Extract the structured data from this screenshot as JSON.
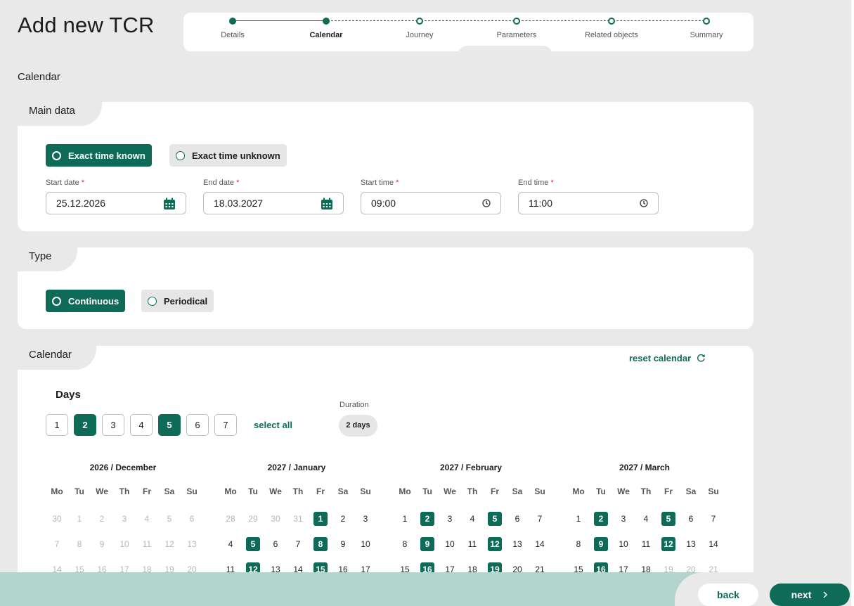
{
  "page": {
    "title": "Add new TCR"
  },
  "stepper": {
    "steps": [
      {
        "label": "Details",
        "state": "done"
      },
      {
        "label": "Calendar",
        "state": "active"
      },
      {
        "label": "Journey",
        "state": "todo"
      },
      {
        "label": "Parameters",
        "state": "todo"
      },
      {
        "label": "Related objects",
        "state": "todo"
      },
      {
        "label": "Summary",
        "state": "todo"
      }
    ]
  },
  "section_title": "Calendar",
  "main_data": {
    "title": "Main data",
    "time_mode": {
      "options": [
        "Exact time known",
        "Exact time unknown"
      ],
      "selected": "Exact time known"
    },
    "fields": {
      "start_date": {
        "label": "Start date",
        "value": "25.12.2026",
        "required_mark": "*"
      },
      "end_date": {
        "label": "End date",
        "value": "18.03.2027",
        "required_mark": "*"
      },
      "start_time": {
        "label": "Start time",
        "value": "09:00",
        "required_mark": "*"
      },
      "end_time": {
        "label": "End time",
        "value": "11:00",
        "required_mark": "*"
      }
    }
  },
  "type": {
    "title": "Type",
    "options": [
      "Continuous",
      "Periodical"
    ],
    "selected": "Continuous"
  },
  "calendar": {
    "title": "Calendar",
    "reset_label": "reset calendar",
    "days_title": "Days",
    "days": [
      "1",
      "2",
      "3",
      "4",
      "5",
      "6",
      "7"
    ],
    "selected_days": [
      "2",
      "5"
    ],
    "select_all_label": "select all",
    "duration_label": "Duration",
    "duration_value": "2 days",
    "weekdays": [
      "Mo",
      "Tu",
      "We",
      "Th",
      "Fr",
      "Sa",
      "Su"
    ],
    "months": [
      {
        "title": "2026 / December",
        "rows": [
          [
            [
              "30",
              "m"
            ],
            [
              "1",
              "m"
            ],
            [
              "2",
              "m"
            ],
            [
              "3",
              "m"
            ],
            [
              "4",
              "m"
            ],
            [
              "5",
              "m"
            ],
            [
              "6",
              "m"
            ]
          ],
          [
            [
              "7",
              "m"
            ],
            [
              "8",
              "m"
            ],
            [
              "9",
              "m"
            ],
            [
              "10",
              "m"
            ],
            [
              "11",
              "m"
            ],
            [
              "12",
              "m"
            ],
            [
              "13",
              "m"
            ]
          ],
          [
            [
              "14",
              "m"
            ],
            [
              "15",
              "m"
            ],
            [
              "16",
              "m"
            ],
            [
              "17",
              "m"
            ],
            [
              "18",
              "m"
            ],
            [
              "19",
              "m"
            ],
            [
              "20",
              "m"
            ]
          ]
        ]
      },
      {
        "title": "2027 / January",
        "rows": [
          [
            [
              "28",
              "m"
            ],
            [
              "29",
              "m"
            ],
            [
              "30",
              "m"
            ],
            [
              "31",
              "m"
            ],
            [
              "1",
              "h"
            ],
            [
              "2",
              "n"
            ],
            [
              "3",
              "n"
            ]
          ],
          [
            [
              "4",
              "n"
            ],
            [
              "5",
              "h"
            ],
            [
              "6",
              "n"
            ],
            [
              "7",
              "n"
            ],
            [
              "8",
              "h"
            ],
            [
              "9",
              "n"
            ],
            [
              "10",
              "n"
            ]
          ],
          [
            [
              "11",
              "n"
            ],
            [
              "12",
              "h"
            ],
            [
              "13",
              "n"
            ],
            [
              "14",
              "n"
            ],
            [
              "15",
              "h"
            ],
            [
              "16",
              "n"
            ],
            [
              "17",
              "n"
            ]
          ]
        ]
      },
      {
        "title": "2027 / February",
        "rows": [
          [
            [
              "1",
              "n"
            ],
            [
              "2",
              "h"
            ],
            [
              "3",
              "n"
            ],
            [
              "4",
              "n"
            ],
            [
              "5",
              "h"
            ],
            [
              "6",
              "n"
            ],
            [
              "7",
              "n"
            ]
          ],
          [
            [
              "8",
              "n"
            ],
            [
              "9",
              "h"
            ],
            [
              "10",
              "n"
            ],
            [
              "11",
              "n"
            ],
            [
              "12",
              "h"
            ],
            [
              "13",
              "n"
            ],
            [
              "14",
              "n"
            ]
          ],
          [
            [
              "15",
              "n"
            ],
            [
              "16",
              "h"
            ],
            [
              "17",
              "n"
            ],
            [
              "18",
              "n"
            ],
            [
              "19",
              "h"
            ],
            [
              "20",
              "n"
            ],
            [
              "21",
              "n"
            ]
          ]
        ]
      },
      {
        "title": "2027 / March",
        "rows": [
          [
            [
              "1",
              "n"
            ],
            [
              "2",
              "h"
            ],
            [
              "3",
              "n"
            ],
            [
              "4",
              "n"
            ],
            [
              "5",
              "h"
            ],
            [
              "6",
              "n"
            ],
            [
              "7",
              "n"
            ]
          ],
          [
            [
              "8",
              "n"
            ],
            [
              "9",
              "h"
            ],
            [
              "10",
              "n"
            ],
            [
              "11",
              "n"
            ],
            [
              "12",
              "h"
            ],
            [
              "13",
              "n"
            ],
            [
              "14",
              "n"
            ]
          ],
          [
            [
              "15",
              "n"
            ],
            [
              "16",
              "h"
            ],
            [
              "17",
              "n"
            ],
            [
              "18",
              "n"
            ],
            [
              "19",
              "m"
            ],
            [
              "20",
              "m"
            ],
            [
              "21",
              "m"
            ]
          ]
        ]
      }
    ]
  },
  "footer": {
    "back_label": "back",
    "next_label": "next"
  },
  "colors": {
    "primary": "#0d6b57",
    "background": "#e9e9e9",
    "footer": "#b2d4cd",
    "required": "#d32f2f"
  },
  "icons": {
    "date_field": "calendar-icon",
    "time_field": "clock-icon",
    "reset": "refresh-icon",
    "next": "chevron-right-icon"
  }
}
